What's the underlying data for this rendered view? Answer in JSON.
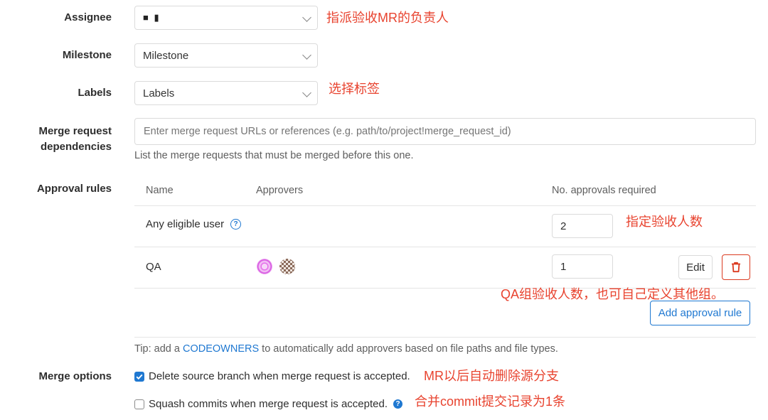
{
  "fields": {
    "assignee": {
      "label": "Assignee",
      "value": "■ ▮",
      "annotation": "指派验收MR的负责人"
    },
    "milestone": {
      "label": "Milestone",
      "value": "Milestone"
    },
    "labels": {
      "label": "Labels",
      "value": "Labels",
      "annotation": "选择标签"
    },
    "dependencies": {
      "label_line1": "Merge request",
      "label_line2": "dependencies",
      "placeholder": "Enter merge request URLs or references (e.g. path/to/project!merge_request_id)",
      "help": "List the merge requests that must be merged before this one."
    }
  },
  "approval": {
    "label": "Approval rules",
    "columns": {
      "name": "Name",
      "approvers": "Approvers",
      "required": "No. approvals required"
    },
    "rows": [
      {
        "name": "Any eligible user",
        "required": "2",
        "annotation": "指定验收人数"
      },
      {
        "name": "QA",
        "required": "1",
        "edit_label": "Edit"
      }
    ],
    "annotation_qa": "QA组验收人数，也可自己定义其他组。",
    "add_rule_label": "Add approval rule",
    "tip_prefix": "Tip: add a ",
    "tip_link": "CODEOWNERS",
    "tip_suffix": " to automatically add approvers based on file paths and file types."
  },
  "merge_options": {
    "label": "Merge options",
    "delete_branch": {
      "text": "Delete source branch when merge request is accepted.",
      "checked": true,
      "annotation": "MR以后自动删除源分支"
    },
    "squash": {
      "text": "Squash commits when merge request is accepted.",
      "checked": false,
      "annotation": "合并commit提交记录为1条"
    }
  },
  "colors": {
    "accent": "#1f78d1",
    "danger": "#db3b21",
    "annotation": "#e8432f"
  }
}
